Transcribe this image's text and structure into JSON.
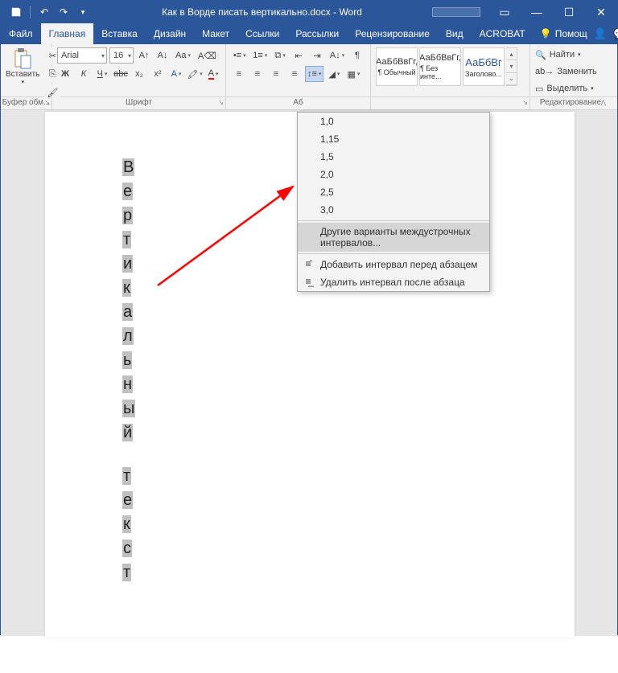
{
  "title": "Как в Ворде писать вертикально.docx - Word",
  "tabs": [
    "Файл",
    "Главная",
    "Вставка",
    "Дизайн",
    "Макет",
    "Ссылки",
    "Рассылки",
    "Рецензирование",
    "Вид",
    "ACROBAT"
  ],
  "active_tab": 1,
  "help_hint": "Помощ",
  "font": {
    "name": "Arial",
    "size": "16"
  },
  "styles": [
    {
      "sample": "АаБбВвГг,",
      "label": "¶ Обычный"
    },
    {
      "sample": "АаБбВвГг,",
      "label": "¶ Без инте..."
    },
    {
      "sample": "АаБбВг",
      "label": "Заголово..."
    }
  ],
  "editing": {
    "find": "Найти",
    "replace": "Заменить",
    "select": "Выделить"
  },
  "group_labels": {
    "clipboard": "Буфер обм...",
    "font": "Шрифт",
    "paragraph": "Аб",
    "styles": "",
    "editing": "Редактирование"
  },
  "paste_label": "Вставить",
  "line_spacing_menu": {
    "values": [
      "1,0",
      "1,15",
      "1,5",
      "2,0",
      "2,5",
      "3,0"
    ],
    "more": "Другие варианты междустрочных интервалов...",
    "add_before": "Добавить интервал перед абзацем",
    "remove_after": "Удалить интервал после абзаца"
  },
  "vertical_word1": "Вертикальный",
  "vertical_word2": "текст"
}
